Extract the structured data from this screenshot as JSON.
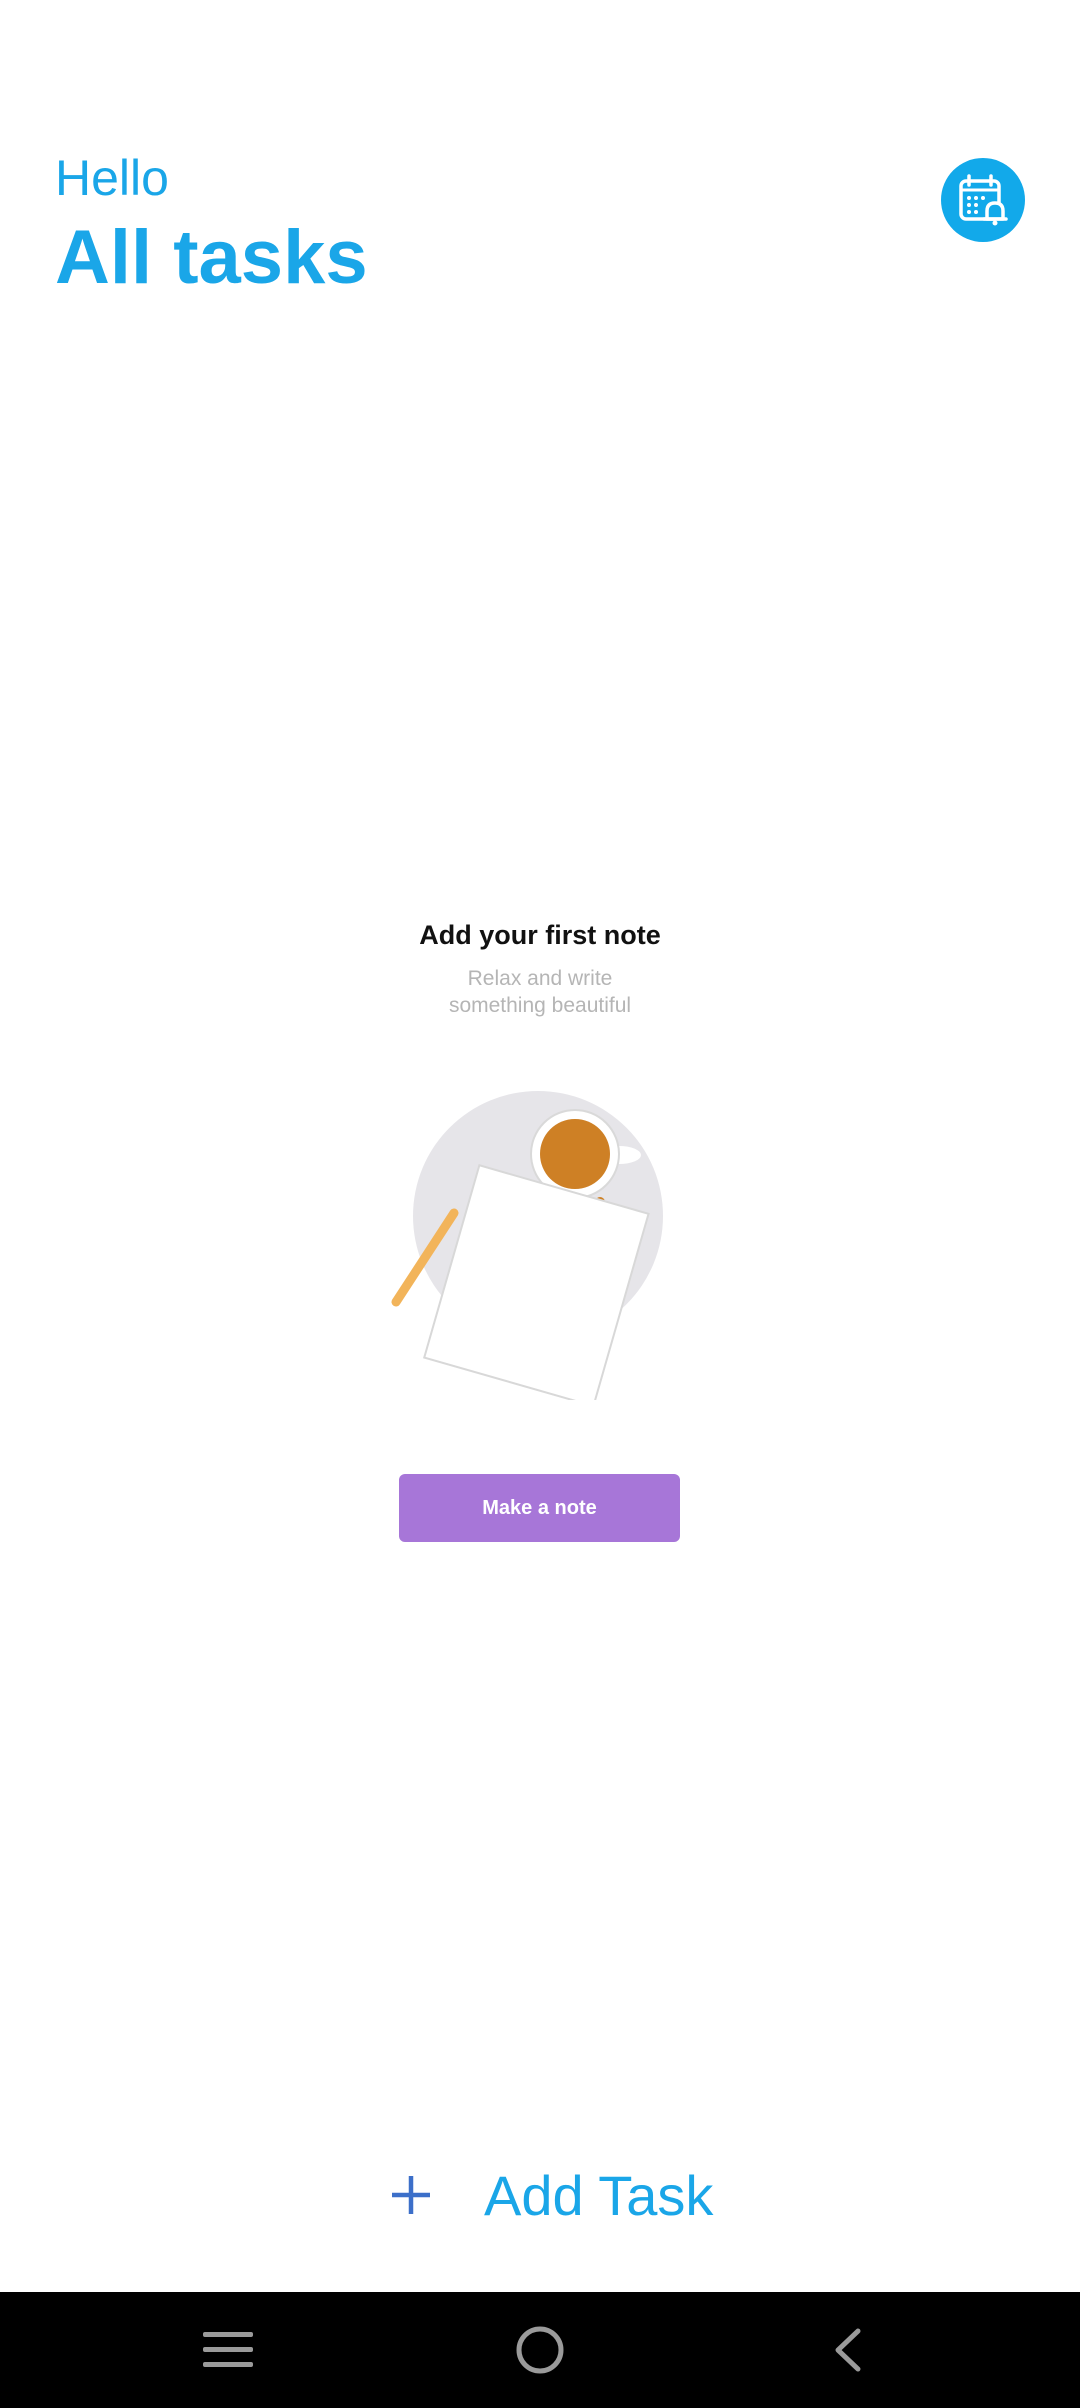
{
  "header": {
    "greeting": "Hello",
    "title": "All tasks"
  },
  "icons": {
    "calendar": "calendar-bell-icon",
    "plus": "plus-icon",
    "menu": "menu-icon",
    "home": "home-icon",
    "back": "back-icon"
  },
  "empty_state": {
    "title": "Add your first note",
    "subtitle": "Relax and write\nsomething beautiful",
    "button_label": "Make a note"
  },
  "footer": {
    "add_task_label": "Add Task"
  },
  "colors": {
    "accent": "#1aa6e8",
    "button": "#a776d8",
    "nav_bar": "#000000"
  }
}
